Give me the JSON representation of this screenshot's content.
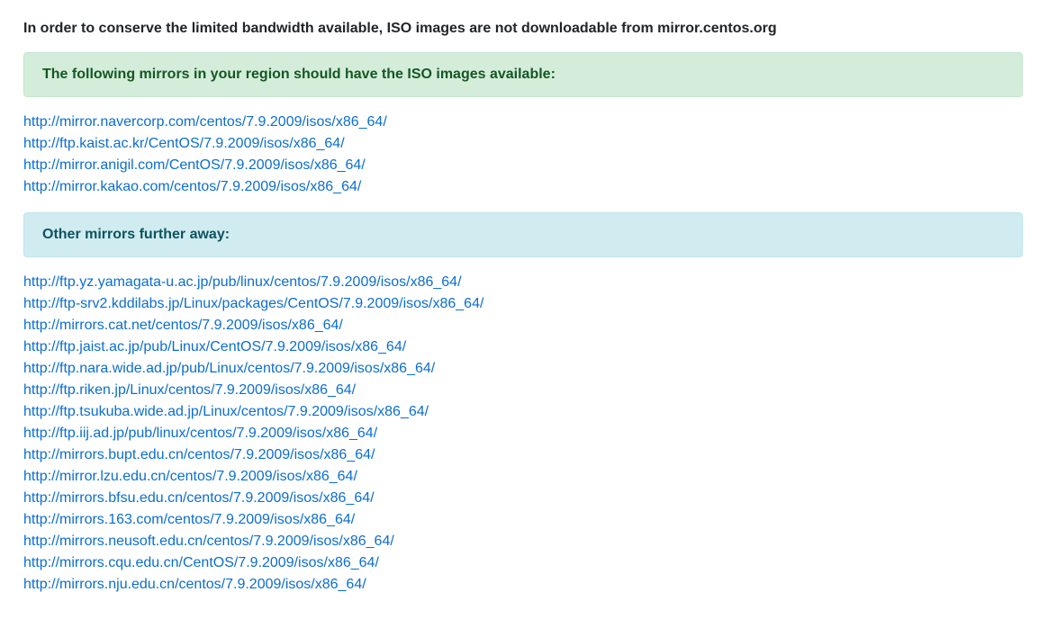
{
  "notice": "In order to conserve the limited bandwidth available, ISO images are not downloadable from mirror.centos.org",
  "regional": {
    "heading": "The following mirrors in your region should have the ISO images available:",
    "mirrors": [
      "http://mirror.navercorp.com/centos/7.9.2009/isos/x86_64/",
      "http://ftp.kaist.ac.kr/CentOS/7.9.2009/isos/x86_64/",
      "http://mirror.anigil.com/CentOS/7.9.2009/isos/x86_64/",
      "http://mirror.kakao.com/centos/7.9.2009/isos/x86_64/"
    ]
  },
  "other": {
    "heading": "Other mirrors further away:",
    "mirrors": [
      "http://ftp.yz.yamagata-u.ac.jp/pub/linux/centos/7.9.2009/isos/x86_64/",
      "http://ftp-srv2.kddilabs.jp/Linux/packages/CentOS/7.9.2009/isos/x86_64/",
      "http://mirrors.cat.net/centos/7.9.2009/isos/x86_64/",
      "http://ftp.jaist.ac.jp/pub/Linux/CentOS/7.9.2009/isos/x86_64/",
      "http://ftp.nara.wide.ad.jp/pub/Linux/centos/7.9.2009/isos/x86_64/",
      "http://ftp.riken.jp/Linux/centos/7.9.2009/isos/x86_64/",
      "http://ftp.tsukuba.wide.ad.jp/Linux/centos/7.9.2009/isos/x86_64/",
      "http://ftp.iij.ad.jp/pub/linux/centos/7.9.2009/isos/x86_64/",
      "http://mirrors.bupt.edu.cn/centos/7.9.2009/isos/x86_64/",
      "http://mirror.lzu.edu.cn/centos/7.9.2009/isos/x86_64/",
      "http://mirrors.bfsu.edu.cn/centos/7.9.2009/isos/x86_64/",
      "http://mirrors.163.com/centos/7.9.2009/isos/x86_64/",
      "http://mirrors.neusoft.edu.cn/centos/7.9.2009/isos/x86_64/",
      "http://mirrors.cqu.edu.cn/CentOS/7.9.2009/isos/x86_64/",
      "http://mirrors.nju.edu.cn/centos/7.9.2009/isos/x86_64/"
    ]
  },
  "colors": {
    "link": "#0b6ed0",
    "success_bg": "#d4edda",
    "success_text": "#155724",
    "info_bg": "#d1ecf1",
    "info_text": "#0c5460"
  }
}
